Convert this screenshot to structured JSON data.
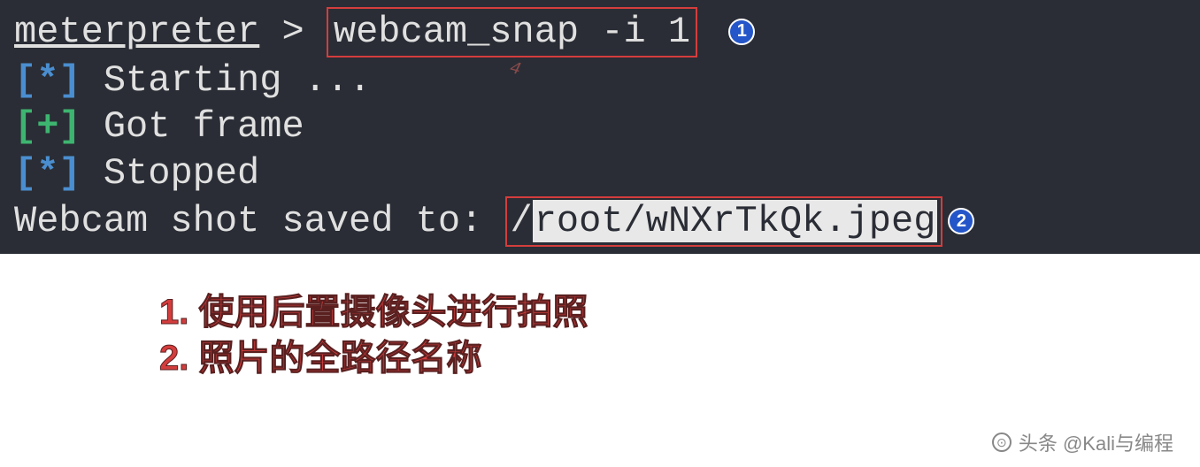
{
  "terminal": {
    "prompt": "meterpreter",
    "prompt_symbol": " > ",
    "command": "webcam_snap -i 1",
    "lines": [
      {
        "prefix": "[*]",
        "prefix_style": "blue",
        "text": "  Starting ..."
      },
      {
        "prefix": "[+]",
        "prefix_style": "green",
        "text": "  Got frame"
      },
      {
        "prefix": "[*]",
        "prefix_style": "blue",
        "text": "  Stopped"
      }
    ],
    "saved_prefix": "Webcam shot saved to: ",
    "saved_path_slash": "/",
    "saved_path_highlight": "root/wNXrTkQk.jpeg"
  },
  "badges": {
    "one": "1",
    "two": "2"
  },
  "annotations": {
    "line1": "1. 使用后置摄像头进行拍照",
    "line2": "2. 照片的全路径名称"
  },
  "watermark": {
    "text": "头条 @Kali与编程"
  },
  "cursor_hint": "4"
}
